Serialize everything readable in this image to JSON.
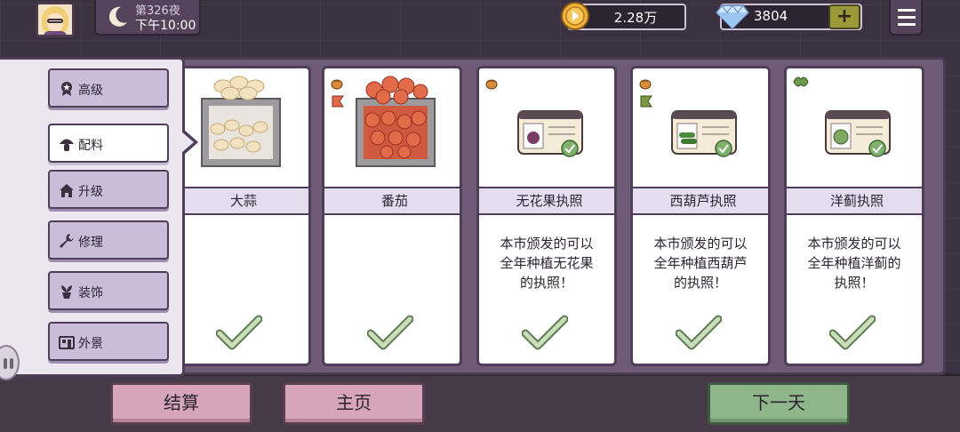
{
  "hud": {
    "night_label": "第326夜",
    "time_label": "下午10:00",
    "coins": "2.28万",
    "gems": "3804",
    "add_gems_label": "+"
  },
  "sidebar": {
    "items": [
      {
        "label": "高级",
        "icon": "ribbon-badge-icon",
        "active": false
      },
      {
        "label": "配料",
        "icon": "mushroom-icon",
        "active": true
      },
      {
        "label": "升级",
        "icon": "house-icon",
        "active": false
      },
      {
        "label": "修理",
        "icon": "wrench-icon",
        "active": false
      },
      {
        "label": "装饰",
        "icon": "potted-plant-icon",
        "active": false
      },
      {
        "label": "外景",
        "icon": "storefront-icon",
        "active": false
      }
    ]
  },
  "cards": [
    {
      "name": "大蒜",
      "desc": "",
      "purchased": true
    },
    {
      "name": "番茄",
      "desc": "",
      "purchased": true
    },
    {
      "name": "无花果执照",
      "desc_lines": [
        "本市颁发的可以",
        "全年种植无花果",
        "的执照！"
      ],
      "purchased": true
    },
    {
      "name": "西葫芦执照",
      "desc_lines": [
        "本市颁发的可以",
        "全年种植西葫芦",
        "的执照！"
      ],
      "purchased": true
    },
    {
      "name": "洋蓟执照",
      "desc_lines": [
        "本市颁发的可以",
        "全年种植洋蓟的",
        "执照！"
      ],
      "purchased": true
    }
  ],
  "buttons": {
    "settle": "结算",
    "home": "主页",
    "next_day": "下一天"
  },
  "colors": {
    "panel": "#6f5a78",
    "card_name_bar": "#e4dcef",
    "check_green": "#a8c79a",
    "pink_button": "#d7a5ba",
    "green_button": "#8fb58a"
  }
}
